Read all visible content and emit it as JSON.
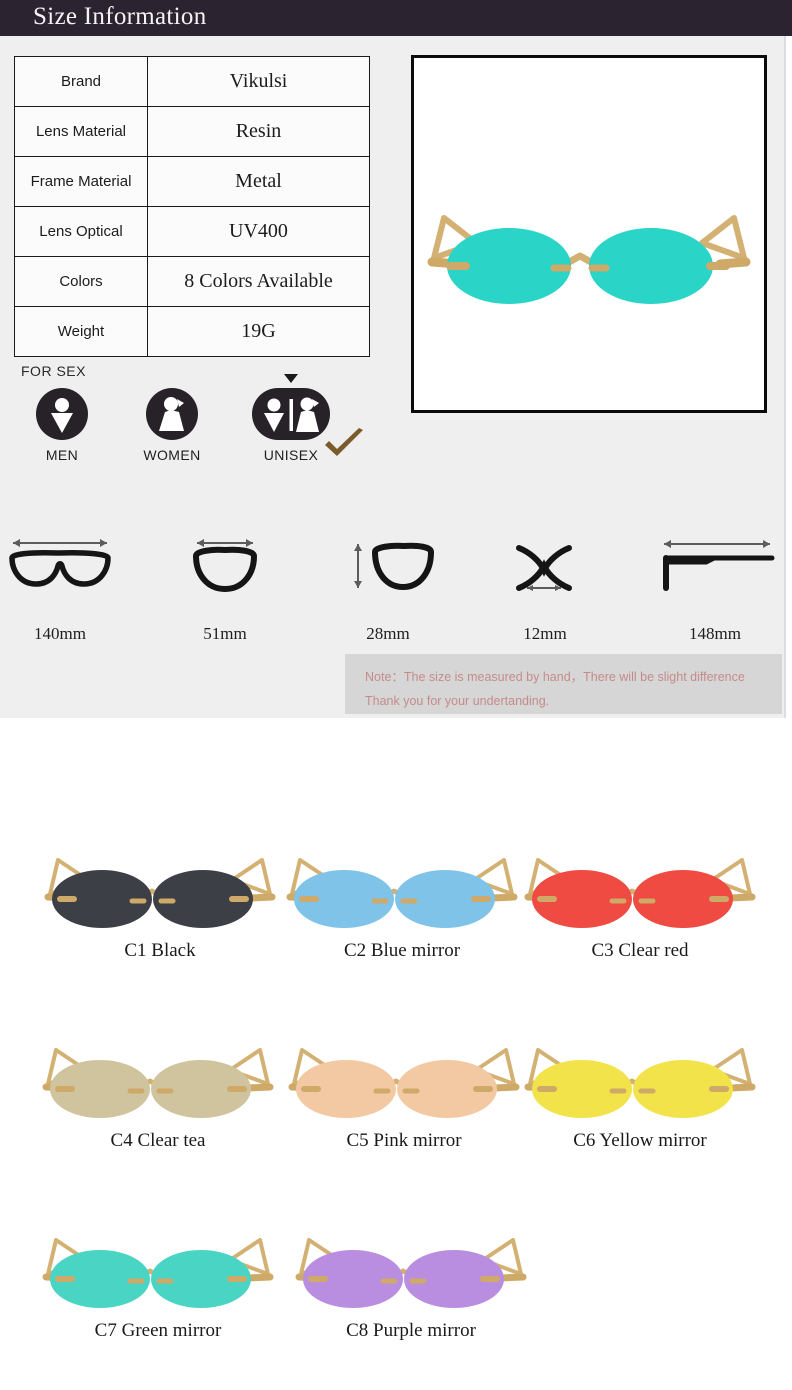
{
  "header": {
    "title": "Size Information"
  },
  "spec_table": {
    "rows": [
      {
        "label": "Brand",
        "value": "Vikulsi"
      },
      {
        "label": "Lens Material",
        "value": "Resin"
      },
      {
        "label": "Frame Material",
        "value": "Metal"
      },
      {
        "label": "Lens Optical",
        "value": "UV400"
      },
      {
        "label": "Colors",
        "value": "8 Colors Available"
      },
      {
        "label": "Weight",
        "value": "19G"
      }
    ]
  },
  "product_photo": {
    "icon": "sunglasses-icon",
    "lens_color": "#2ad5c8",
    "frame_color": "#d8b87a"
  },
  "for_sex": {
    "label": "FOR SEX",
    "options": [
      {
        "name": "MEN",
        "icon": "male-figure-icon",
        "selected": false
      },
      {
        "name": "WOMEN",
        "icon": "female-figure-icon",
        "selected": false
      },
      {
        "name": "UNISEX",
        "icon": "unisex-figure-icon",
        "selected": true
      }
    ],
    "check_color": "#7b5a2b"
  },
  "measurements": [
    {
      "value": "140mm",
      "icon": "frame-width-icon"
    },
    {
      "value": "51mm",
      "icon": "lens-width-icon"
    },
    {
      "value": "28mm",
      "icon": "lens-height-icon"
    },
    {
      "value": "12mm",
      "icon": "bridge-width-icon"
    },
    {
      "value": "148mm",
      "icon": "temple-length-icon"
    }
  ],
  "note": {
    "line1": "Note：The size is measured by hand，There will be slight difference",
    "line2": "Thank you for your undertanding.",
    "text_color": "#c58b8b",
    "background": "#d6d6d6"
  },
  "colors": {
    "rows": [
      [
        {
          "label": "C1 Black",
          "lens": "#3c4046"
        },
        {
          "label": "C2 Blue mirror",
          "lens": "#7fc3e8"
        },
        {
          "label": "C3 Clear red",
          "lens": "#ef4b42"
        }
      ],
      [
        {
          "label": "C4 Clear tea",
          "lens": "#cfc49e"
        },
        {
          "label": "C5 Pink mirror",
          "lens": "#f3c9a3"
        },
        {
          "label": "C6 Yellow mirror",
          "lens": "#f2e34a"
        }
      ],
      [
        {
          "label": "C7 Green mirror",
          "lens": "#4ad4c4"
        },
        {
          "label": "C8 Purple mirror",
          "lens": "#b98ee0"
        }
      ]
    ]
  }
}
